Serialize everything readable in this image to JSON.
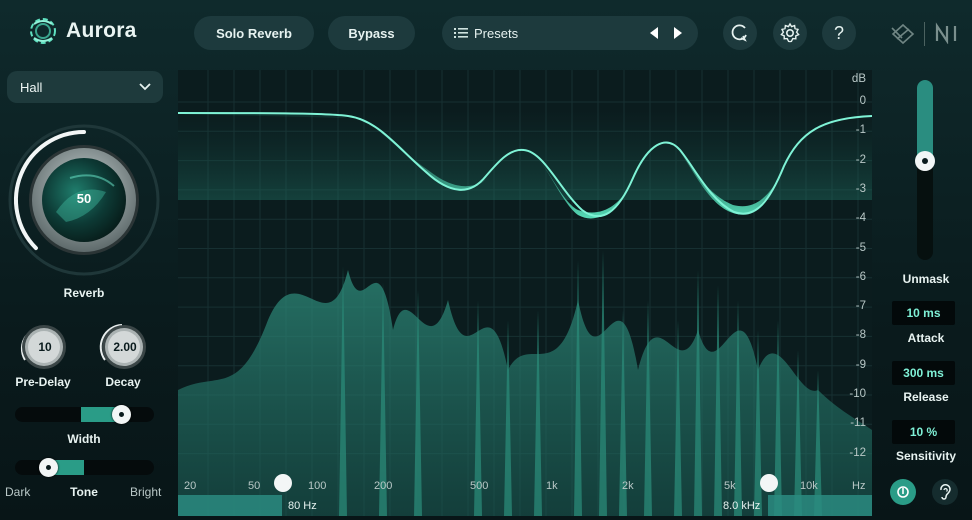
{
  "app": {
    "name": "Aurora"
  },
  "header": {
    "solo_label": "Solo Reverb",
    "bypass_label": "Bypass",
    "presets_label": "Presets"
  },
  "left": {
    "room_type": "Hall",
    "reverb": {
      "value": "50",
      "label": "Reverb",
      "level": 0.5
    },
    "pre_delay": {
      "value": "10",
      "label": "Pre-Delay"
    },
    "decay": {
      "value": "2.00",
      "label": "Decay"
    },
    "width": {
      "label": "Width",
      "level": 0.76
    },
    "tone": {
      "label": "Tone",
      "dark_label": "Dark",
      "bright_label": "Bright",
      "level": 0.24
    }
  },
  "graph": {
    "db_unit": "dB",
    "db_ticks": [
      "0",
      "-1",
      "-2",
      "-3",
      "-4",
      "-5",
      "-6",
      "-7",
      "-8",
      "-9",
      "-10",
      "-11",
      "-12"
    ],
    "freq_ticks": [
      "20",
      "50",
      "100",
      "200",
      "500",
      "1k",
      "2k",
      "5k",
      "10k",
      "Hz"
    ],
    "low_cut": "80 Hz",
    "high_cut": "8.0 kHz"
  },
  "right": {
    "unmask_label": "Unmask",
    "unmask_level": 0.45,
    "attack_value": "10 ms",
    "attack_label": "Attack",
    "release_value": "300 ms",
    "release_label": "Release",
    "sensitivity_value": "10 %",
    "sensitivity_label": "Sensitivity"
  },
  "colors": {
    "accent": "#5fe0c0",
    "panel": "#1d3a3d",
    "background": "#0b1a1c"
  },
  "icons": [
    "aurora-logo-icon",
    "list-icon",
    "prev-arrow-icon",
    "next-arrow-icon",
    "loop-icon",
    "gear-icon",
    "help-icon",
    "izotope-logo-icon",
    "ni-logo-icon",
    "chevron-down-icon",
    "power-icon",
    "ear-icon"
  ]
}
